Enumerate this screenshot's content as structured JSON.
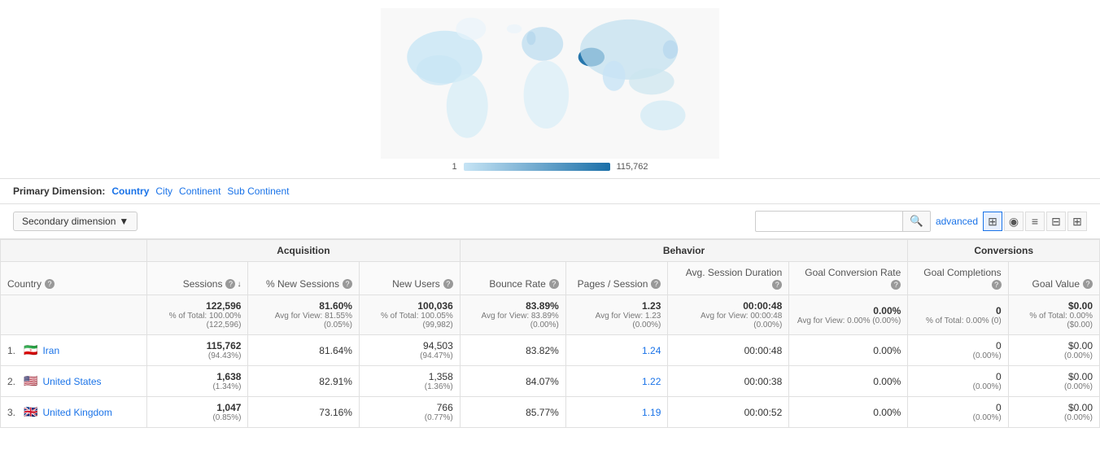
{
  "map": {
    "legend_min": "1",
    "legend_max": "115,762"
  },
  "primary_dimension": {
    "label": "Primary Dimension:",
    "options": [
      "Country",
      "City",
      "Continent",
      "Sub Continent"
    ],
    "active": "Country"
  },
  "toolbar": {
    "secondary_dim_label": "Secondary dimension",
    "search_placeholder": "",
    "advanced_label": "advanced"
  },
  "view_icons": [
    "⊞",
    "◉",
    "≡",
    "⊟",
    "⊞⊞"
  ],
  "table": {
    "group_headers": [
      {
        "label": "",
        "colspan": 1
      },
      {
        "label": "Acquisition",
        "colspan": 3
      },
      {
        "label": "Behavior",
        "colspan": 4
      },
      {
        "label": "Conversions",
        "colspan": 3
      }
    ],
    "col_headers": [
      {
        "key": "country",
        "label": "Country",
        "align": "left",
        "has_help": true,
        "sort": false
      },
      {
        "key": "sessions",
        "label": "Sessions",
        "align": "right",
        "has_help": true,
        "sort": true
      },
      {
        "key": "pct_new_sessions",
        "label": "% New Sessions",
        "align": "right",
        "has_help": true,
        "sort": false
      },
      {
        "key": "new_users",
        "label": "New Users",
        "align": "right",
        "has_help": true,
        "sort": false
      },
      {
        "key": "bounce_rate",
        "label": "Bounce Rate",
        "align": "right",
        "has_help": true,
        "sort": false
      },
      {
        "key": "pages_per_session",
        "label": "Pages / Session",
        "align": "right",
        "has_help": true,
        "sort": false
      },
      {
        "key": "avg_session_duration",
        "label": "Avg. Session Duration",
        "align": "right",
        "has_help": true,
        "sort": false
      },
      {
        "key": "goal_conv_rate",
        "label": "Goal Conversion Rate",
        "align": "right",
        "has_help": true,
        "sort": false
      },
      {
        "key": "goal_completions",
        "label": "Goal Completions",
        "align": "right",
        "has_help": true,
        "sort": false
      },
      {
        "key": "goal_value",
        "label": "Goal Value",
        "align": "right",
        "has_help": true,
        "sort": false
      }
    ],
    "totals": {
      "country": "",
      "sessions": "122,596",
      "sessions_sub": "% of Total: 100.00% (122,596)",
      "pct_new_sessions": "81.60%",
      "pct_new_sessions_sub": "Avg for View: 81.55% (0.05%)",
      "new_users": "100,036",
      "new_users_sub": "% of Total: 100.05% (99,982)",
      "bounce_rate": "83.89%",
      "bounce_rate_sub": "Avg for View: 83.89% (0.00%)",
      "pages_per_session": "1.23",
      "pages_per_session_sub": "Avg for View: 1.23 (0.00%)",
      "avg_session_duration": "00:00:48",
      "avg_session_duration_sub": "Avg for View: 00:00:48 (0.00%)",
      "goal_conv_rate": "0.00%",
      "goal_conv_rate_sub": "Avg for View: 0.00% (0.00%)",
      "goal_completions": "0",
      "goal_completions_sub": "% of Total: 0.00% (0)",
      "goal_value": "$0.00",
      "goal_value_sub": "% of Total: 0.00% ($0.00)"
    },
    "rows": [
      {
        "rank": "1.",
        "country": "Iran",
        "flag": "ir",
        "sessions": "115,762",
        "sessions_pct": "(94.43%)",
        "pct_new_sessions": "81.64%",
        "new_users": "94,503",
        "new_users_pct": "(94.47%)",
        "bounce_rate": "83.82%",
        "pages_per_session": "1.24",
        "avg_session_duration": "00:00:48",
        "goal_conv_rate": "0.00%",
        "goal_completions": "0",
        "goal_completions_pct": "(0.00%)",
        "goal_value": "$0.00",
        "goal_value_pct": "(0.00%)"
      },
      {
        "rank": "2.",
        "country": "United States",
        "flag": "us",
        "sessions": "1,638",
        "sessions_pct": "(1.34%)",
        "pct_new_sessions": "82.91%",
        "new_users": "1,358",
        "new_users_pct": "(1.36%)",
        "bounce_rate": "84.07%",
        "pages_per_session": "1.22",
        "avg_session_duration": "00:00:38",
        "goal_conv_rate": "0.00%",
        "goal_completions": "0",
        "goal_completions_pct": "(0.00%)",
        "goal_value": "$0.00",
        "goal_value_pct": "(0.00%)"
      },
      {
        "rank": "3.",
        "country": "United Kingdom",
        "flag": "gb",
        "sessions": "1,047",
        "sessions_pct": "(0.85%)",
        "pct_new_sessions": "73.16%",
        "new_users": "766",
        "new_users_pct": "(0.77%)",
        "bounce_rate": "85.77%",
        "pages_per_session": "1.19",
        "avg_session_duration": "00:00:52",
        "goal_conv_rate": "0.00%",
        "goal_completions": "0",
        "goal_completions_pct": "(0.00%)",
        "goal_value": "$0.00",
        "goal_value_pct": "(0.00%)"
      }
    ]
  }
}
